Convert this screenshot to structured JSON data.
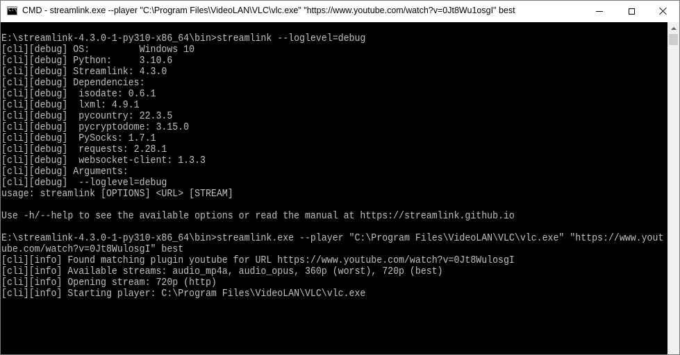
{
  "window": {
    "title": "CMD - streamlink.exe  --player \"C:\\Program Files\\VideoLAN\\VLC\\vlc.exe\" \"https://www.youtube.com/watch?v=0Jt8Wu1osgI\" best",
    "app_icon_text": "C:\\"
  },
  "colors": {
    "console_background": "#000000",
    "console_text": "#c0c0c0",
    "titlebar_background": "#ffffff"
  },
  "icons": {
    "app": "cmd-icon",
    "minimize": "minimize-icon",
    "maximize": "maximize-icon",
    "close": "close-icon"
  },
  "console": {
    "lines": [
      "E:\\streamlink-4.3.0-1-py310-x86_64\\bin>streamlink --loglevel=debug",
      "[cli][debug] OS:         Windows 10",
      "[cli][debug] Python:     3.10.6",
      "[cli][debug] Streamlink: 4.3.0",
      "[cli][debug] Dependencies:",
      "[cli][debug]  isodate: 0.6.1",
      "[cli][debug]  lxml: 4.9.1",
      "[cli][debug]  pycountry: 22.3.5",
      "[cli][debug]  pycryptodome: 3.15.0",
      "[cli][debug]  PySocks: 1.7.1",
      "[cli][debug]  requests: 2.28.1",
      "[cli][debug]  websocket-client: 1.3.3",
      "[cli][debug] Arguments:",
      "[cli][debug]  --loglevel=debug",
      "usage: streamlink [OPTIONS] <URL> [STREAM]",
      "",
      "Use -h/--help to see the available options or read the manual at https://streamlink.github.io",
      "",
      "E:\\streamlink-4.3.0-1-py310-x86_64\\bin>streamlink.exe --player \"C:\\Program Files\\VideoLAN\\VLC\\vlc.exe\" \"https://www.yout",
      "ube.com/watch?v=0Jt8WulosgI\" best",
      "[cli][info] Found matching plugin youtube for URL https://www.youtube.com/watch?v=0Jt8WulosgI",
      "[cli][info] Available streams: audio_mp4a, audio_opus, 360p (worst), 720p (best)",
      "[cli][info] Opening stream: 720p (http)",
      "[cli][info] Starting player: C:\\Program Files\\VideoLAN\\VLC\\vlc.exe"
    ]
  }
}
